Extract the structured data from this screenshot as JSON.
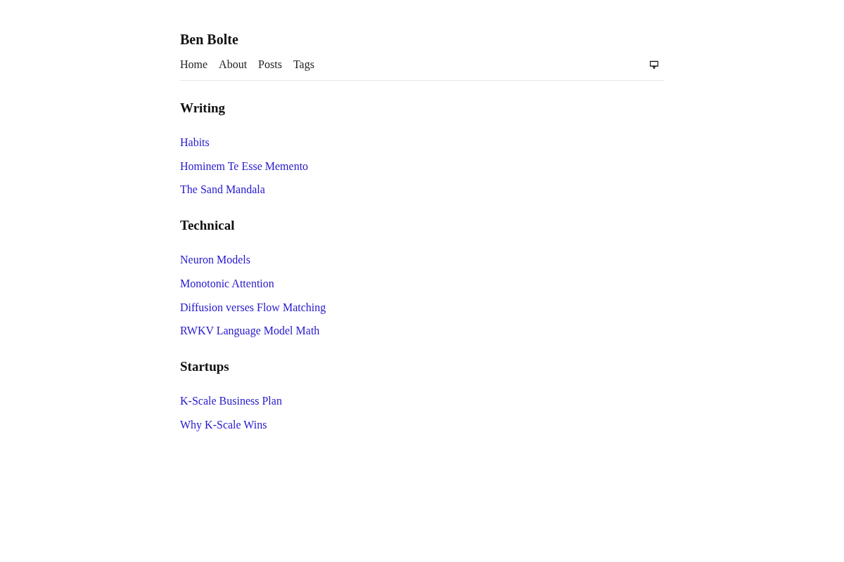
{
  "header": {
    "title": "Ben Bolte",
    "nav": [
      "Home",
      "About",
      "Posts",
      "Tags"
    ]
  },
  "sections": [
    {
      "heading": "Writing",
      "links": [
        "Habits",
        "Hominem Te Esse Memento",
        "The Sand Mandala"
      ]
    },
    {
      "heading": "Technical",
      "links": [
        "Neuron Models",
        "Monotonic Attention",
        "Diffusion verses Flow Matching",
        "RWKV Language Model Math"
      ]
    },
    {
      "heading": "Startups",
      "links": [
        "K-Scale Business Plan",
        "Why K-Scale Wins"
      ]
    }
  ]
}
